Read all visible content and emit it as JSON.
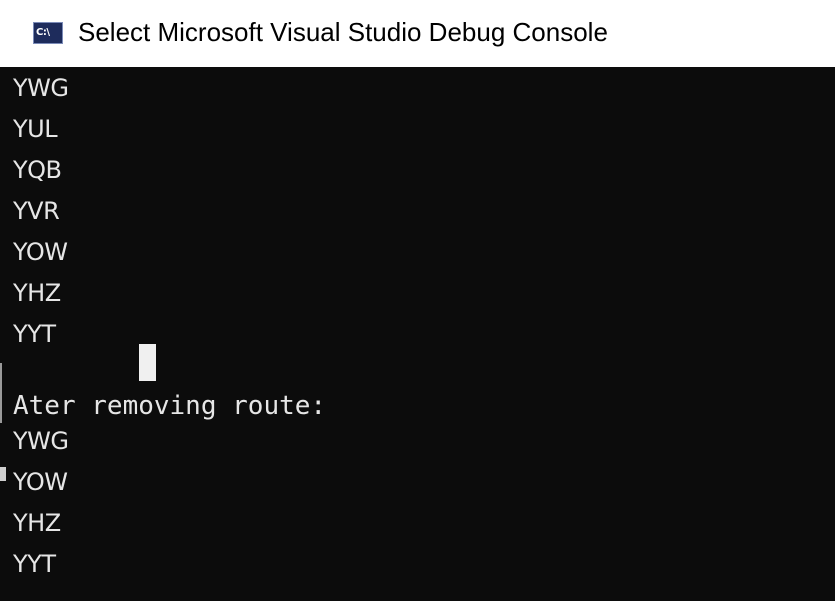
{
  "window": {
    "title": "Select Microsoft Visual Studio Debug Console",
    "icon": "console-app-icon",
    "icon_text": "C:\\"
  },
  "console": {
    "lines_before": [
      "YWG",
      "YUL",
      "YQB",
      "YVR",
      "YOW",
      "YHZ",
      "YYT"
    ],
    "message": "Ater removing route:",
    "lines_after": [
      "YWG",
      "YOW",
      "YHZ",
      "YYT"
    ]
  },
  "colors": {
    "console_background": "#0c0c0c",
    "console_text": "#e6e6e6",
    "title_bar": "#ffffff"
  }
}
